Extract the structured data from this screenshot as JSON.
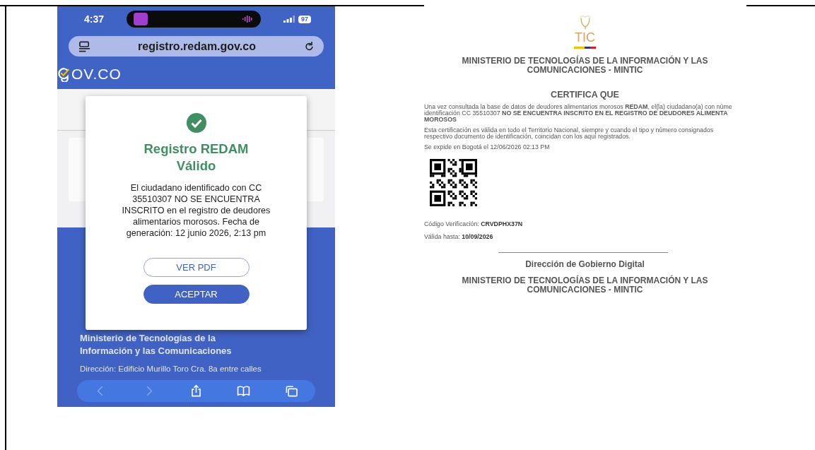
{
  "phone": {
    "status_bar": {
      "time": "4:37",
      "battery": "97"
    },
    "address_bar": {
      "url": "registro.redam.gov.co"
    },
    "site_logo": {
      "text": "OV.CO"
    },
    "dialog": {
      "title": "Registro REDAM Válido",
      "message": "El ciudadano identificado con CC 35510307 NO SE ENCUENTRA INSCRITO en el registro de deudores alimentarios morosos. Fecha de generación: 12 junio 2026, 2:13 pm",
      "buttons": [
        {
          "label": "VER PDF",
          "kind": "outline"
        },
        {
          "label": "ACEPTAR",
          "kind": "filled"
        }
      ]
    },
    "footer": {
      "entity": "Ministerio de Tecnologías de la",
      "entity_line_2": "Información y las Comunicaciones",
      "address": "Dirección: Edificio Murillo Toro Cra. 8a entre calles"
    },
    "toolbar": [
      {
        "kind": "back",
        "disabled": true
      },
      {
        "kind": "forward",
        "disabled": true
      },
      {
        "kind": "share",
        "disabled": false
      },
      {
        "kind": "bookmarks",
        "disabled": false
      },
      {
        "kind": "tabs",
        "disabled": false
      }
    ]
  },
  "certificate": {
    "logo_text": "TIC",
    "heading": "MINISTERIO DE TECNOLOGÍAS DE LA INFORMACIÓN Y LAS COMUNICACIONES - MINTIC",
    "title": "CERTIFICA QUE",
    "paragraph_1": [
      "Una vez consultada la base de datos de deudores alimentarios morosos **REDAM**, el(la) ciudadano(a) con núme",
      "identificación CC 35510307 **NO SE ENCUENTRA INSCRITO EN EL REGISTRO DE DEUDORES ALIMENTA**",
      "**MOROSOS**"
    ],
    "paragraph_2": [
      "Esta certificación es válida en todo el Territorio Nacional, siempre y cuando el tipo y número consignados",
      "respectivo documento de identificación, coincidan con los aquí registrados."
    ],
    "issued": "Se expide en Bogotá el 12/06/2026 02:13 PM",
    "verification": {
      "label": "Código Verificación:",
      "value": "CRVDPHX37N"
    },
    "valid_until": {
      "label": "Válida hasta:",
      "value": "10/09/2026"
    },
    "signature": "Dirección de Gobierno Digital",
    "footer_heading": "MINISTERIO DE TECNOLOGÍAS DE LA INFORMACIÓN Y LAS COMUNICACIONES - MINTIC"
  }
}
